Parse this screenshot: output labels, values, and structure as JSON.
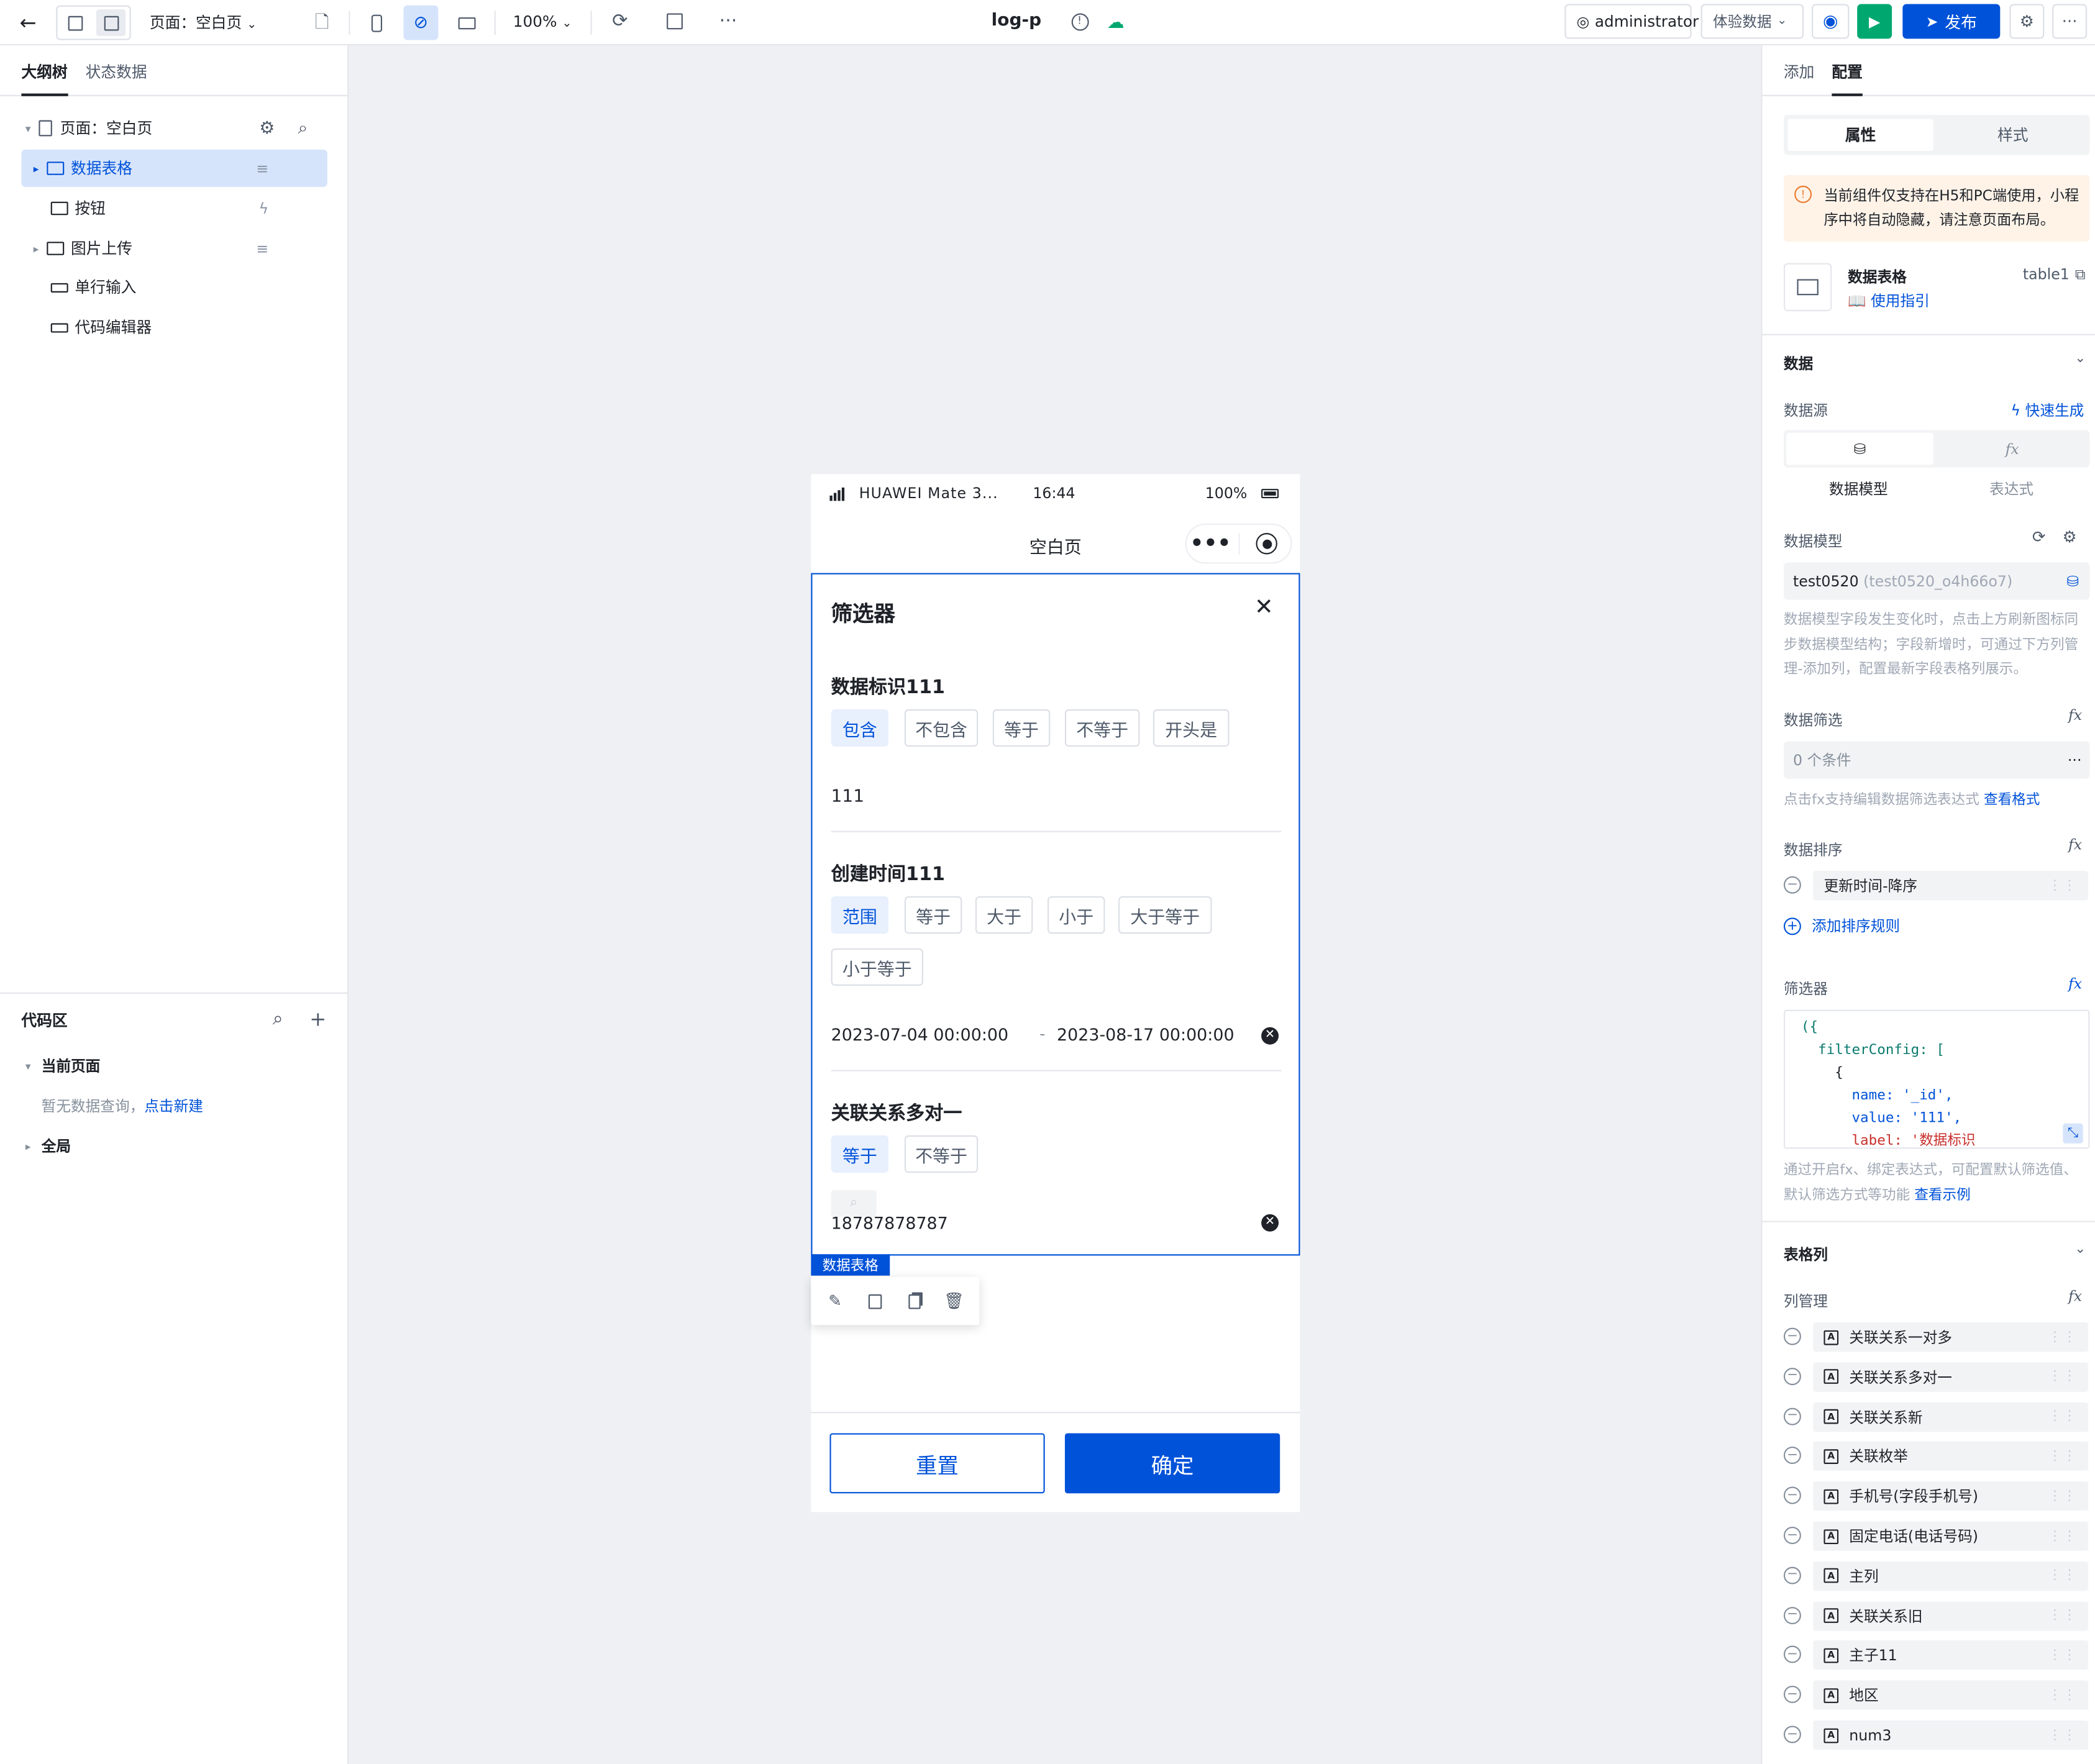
{
  "topbar": {
    "page_label": "页面：空白页",
    "zoom": "100%",
    "app_name": "log-p",
    "user": "administrator",
    "env": "体验数据",
    "publish": "发布"
  },
  "left": {
    "tabs": [
      "大纲树",
      "状态数据"
    ],
    "tree": [
      {
        "label": "页面：空白页",
        "icon": "page-icon"
      },
      {
        "label": "数据表格",
        "icon": "table-icon"
      },
      {
        "label": "按钮",
        "icon": "button-icon"
      },
      {
        "label": "图片上传",
        "icon": "image-upload-icon"
      },
      {
        "label": "单行输入",
        "icon": "input-icon"
      },
      {
        "label": "代码编辑器",
        "icon": "code-editor-icon"
      }
    ],
    "code": {
      "title": "代码区",
      "current": "当前页面",
      "empty": "暂无数据查询，",
      "new_link": "点击新建",
      "global": "全局"
    }
  },
  "phone": {
    "carrier": "HUAWEI Mate 3...",
    "time": "16:44",
    "battery": "100%",
    "page_title": "空白页",
    "filter_title": "筛选器",
    "sections": [
      {
        "title": "数据标识111",
        "chips": [
          "包含",
          "不包含",
          "等于",
          "不等于",
          "开头是"
        ],
        "value": "111"
      },
      {
        "title": "创建时间111",
        "chips": [
          "范围",
          "等于",
          "大于",
          "小于",
          "大于等于",
          "小于等于"
        ],
        "start": "2023-07-04 00:00:00",
        "dash": "-",
        "end": "2023-08-17 00:00:00"
      },
      {
        "title": "关联关系多对一",
        "chips": [
          "等于",
          "不等于"
        ],
        "value": "18787878787"
      }
    ],
    "tag": "数据表格",
    "reset": "重置",
    "confirm": "确定"
  },
  "right": {
    "tabs": [
      "添加",
      "配置"
    ],
    "seg": [
      "属性",
      "样式"
    ],
    "notice": "当前组件仅支持在H5和PC端使用，小程序中将自动隐藏，请注意页面布局。",
    "comp_name": "数据表格",
    "comp_id": "table1",
    "guide": "使用指引",
    "data_section": "数据",
    "datasource": "数据源",
    "quick_gen": "快速生成",
    "ds_options": [
      "数据模型",
      "表达式"
    ],
    "model_label": "数据模型",
    "model_value": "test0520",
    "model_sub": "(test0520_o4h66o7)",
    "model_hint": "数据模型字段发生变化时，点击上方刷新图标同步数据模型结构；字段新增时，可通过下方列管理-添加列，配置最新字段表格列展示。",
    "filter_label": "数据筛选",
    "filter_value": "0 个条件",
    "filter_hint": "点击fx支持编辑数据筛选表达式",
    "filter_link": "查看格式",
    "sort_label": "数据排序",
    "sort_value": "更新时间-降序",
    "add_sort": "添加排序规则",
    "filterer_label": "筛选器",
    "code_lines": [
      "({",
      "  filterConfig: [",
      "    {",
      "      name: '_id',",
      "      value: '111',",
      "      label: '数据标识"
    ],
    "filterer_hint": "通过开启fx、绑定表达式，可配置默认筛选值、默认筛选方式等功能",
    "filterer_link": "查看示例",
    "columns_section": "表格列",
    "col_manage": "列管理",
    "columns": [
      "关联关系一对多",
      "关联关系多对一",
      "关联关系新",
      "关联枚举",
      "手机号(字段手机号)",
      "固定电话(电话号码)",
      "主列",
      "关联关系旧",
      "主子11",
      "地区",
      "num3"
    ]
  },
  "colors": {
    "brand": "#0052d9",
    "publish_green": "#00a870",
    "notice_bg": "#fff3e8",
    "notice_icon": "#ed7b2f"
  }
}
